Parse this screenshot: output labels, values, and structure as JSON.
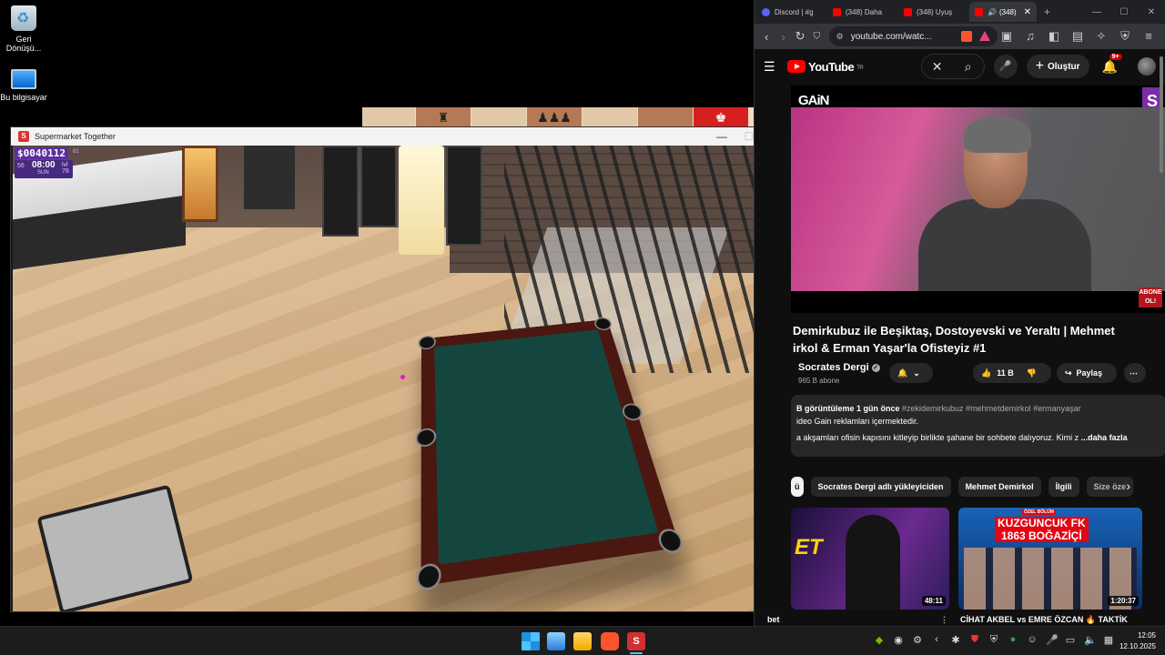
{
  "desktop": {
    "icons": [
      {
        "label": "Geri Dönüşü...",
        "icon": "recycle-bin-icon"
      },
      {
        "label": "Bu bilgisayar",
        "icon": "this-pc-icon"
      }
    ]
  },
  "game_window": {
    "title": "Supermarket Together",
    "app_icon_letter": "S",
    "minimize": "—",
    "maximize": "☐",
    "close": "✕",
    "hud": {
      "money": "$0040112",
      "money_sub": "81",
      "day": "56",
      "time": "08:00",
      "weekday": "SUN",
      "level_label": "lvl",
      "level": "78"
    }
  },
  "background_window": {
    "tiles": [
      "♜",
      "♟♟♟",
      "♚"
    ]
  },
  "browser": {
    "tabs": [
      {
        "title": "Discord | #g",
        "icon": "discord-icon",
        "active": false
      },
      {
        "title": "(348) Daha",
        "icon": "youtube-icon",
        "active": false
      },
      {
        "title": "(348) Uyuş",
        "icon": "youtube-icon",
        "active": false
      },
      {
        "title": "(348)",
        "icon": "youtube-icon",
        "active": true,
        "audio": "🔊"
      }
    ],
    "tab_close": "✕",
    "new_tab": "+",
    "window_controls": {
      "minimize": "—",
      "maximize": "☐",
      "close": "✕"
    },
    "url": "youtube.com/watc...",
    "nav": {
      "back": "‹",
      "forward": "›",
      "reload": "↻",
      "bookmark": "⛉"
    }
  },
  "youtube": {
    "logo_text": "YouTube",
    "region": "TR",
    "search_clear": "✕",
    "search_icon": "⌕",
    "mic_icon": "🎤",
    "create_label": "Oluştur",
    "create_plus": "+",
    "notifications_badge": "9+",
    "video": {
      "channel_logo": "GAiN",
      "s_logo": "S",
      "abone_badge": "ABONE OL!",
      "title": "Demirkubuz ile Beşiktaş, Dostoyevski ve Yeraltı | Mehmet\nirkol & Erman Yaşar'la Ofisteyiz #1"
    },
    "channel": {
      "name": "Socrates Dergi",
      "subscribers": "965 B abone",
      "verified": "✓"
    },
    "actions": {
      "likes": "11 B",
      "share": "Paylaş",
      "more": "⋯"
    },
    "description": {
      "stats": "B görüntüleme  1 gün önce",
      "tags": "#zekidemirkubuz #mehmetdemirkol #ermanyaşar",
      "line2": "ideo Gain reklamları içermektedir.",
      "line3": "a akşamları ofisin kapısını kitleyip birlikte şahane bir sohbete dalıyoruz. Kimi z",
      "more": "...daha fazla"
    },
    "chips": [
      "ü",
      "Socrates Dergi adlı yükleyiciden",
      "Mehmet Demirkol",
      "İlgili",
      "Size öze"
    ],
    "chips_next": "›",
    "recommendations": [
      {
        "thumb_text": "ET",
        "duration": "48:11",
        "caption": "bet"
      },
      {
        "thumb_top": "ÖZEL BÖLÜM",
        "thumb_title": "KUZGUNCUK FK\n1863 BOĞAZİÇİ",
        "duration": "1:20:37",
        "caption": "CİHAT AKBEL vs EMRE ÖZCAN 🔥 TAKTİK"
      }
    ]
  },
  "taskbar": {
    "game_letter": "S",
    "time": "12:05",
    "date": "12.10.2025",
    "tray_icons": [
      "nvidia-icon",
      "steam-icon",
      "steam-icon",
      "chevron-icon",
      "bluetooth-icon",
      "shield-icon",
      "security-icon",
      "xbox-icon",
      "discord-icon",
      "mic-icon",
      "display-icon",
      "volume-icon",
      "network-icon"
    ]
  }
}
